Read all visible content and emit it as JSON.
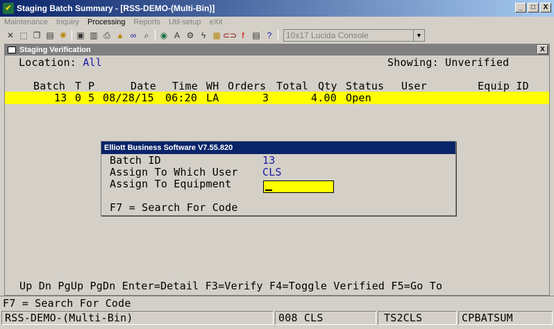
{
  "window": {
    "title": "Staging Batch Summary - [RSS-DEMO-(Multi-Bin)]",
    "min_label": "_",
    "max_label": "□",
    "close_label": "X"
  },
  "menu": {
    "items": [
      "Maintenance",
      "Inquiry",
      "Processing",
      "Reports",
      "Util-setup",
      "eXit"
    ]
  },
  "toolbar": {
    "font_selector": "10x17 Lucida Console"
  },
  "inner": {
    "title": "Staging Verification",
    "close_label": "X",
    "location_label": "Location:",
    "location_value": "All",
    "showing_label": "Showing:",
    "showing_value": "Unverified",
    "table": {
      "headers": [
        "Batch",
        "T",
        "P",
        "Date",
        "Time",
        "WH",
        "Orders",
        "Total",
        "Qty",
        "Status",
        "User",
        "Equip ID"
      ],
      "rows": [
        {
          "batch": "13",
          "t": "0",
          "p": "5",
          "date": "08/28/15",
          "time": "06:20",
          "wh": "LA",
          "orders": "3",
          "total_qty": "4.00",
          "status": "Open",
          "user": "",
          "equip": ""
        }
      ]
    },
    "function_keys": "Up Dn PgUp PgDn Enter=Detail F3=Verify F4=Toggle Verified F5=Go To"
  },
  "dialog": {
    "title": "Elliott Business Software V7.55.820",
    "batch_label": "Batch ID",
    "batch_value": "13",
    "user_label": "Assign To Which User",
    "user_value": "CLS",
    "equip_label": "Assign To Equipment",
    "equip_value": "",
    "hint": "F7 = Search For Code"
  },
  "status": {
    "hint": "F7 = Search For Code",
    "company": "RSS-DEMO-(Multi-Bin)",
    "user": "008 CLS",
    "terminal": "TS2CLS",
    "program": "CPBATSUM"
  },
  "colors": {
    "highlight": "#ffff00",
    "title_active": "#0a246a",
    "value_blue": "#1a1aa6"
  }
}
